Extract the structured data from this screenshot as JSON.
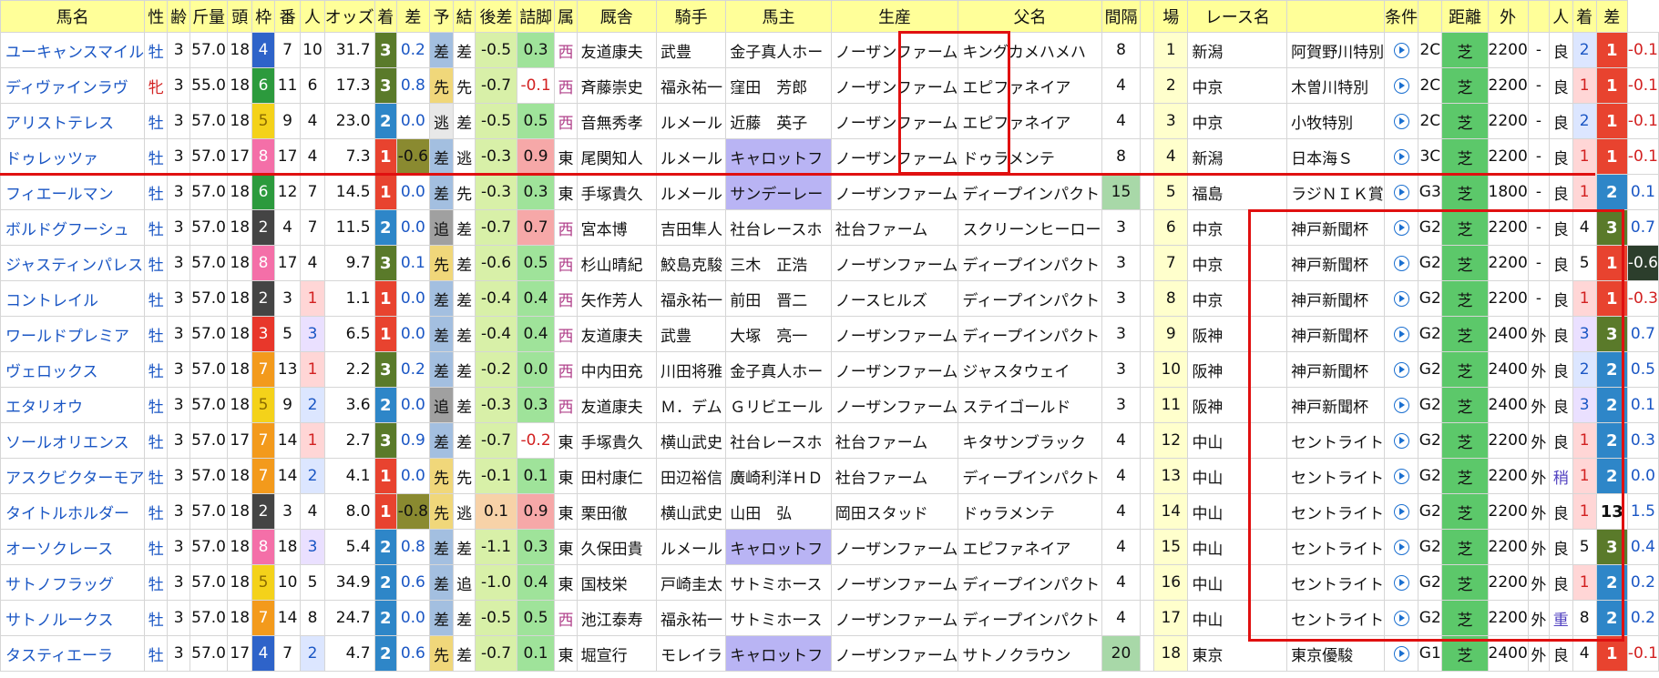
{
  "headers": [
    "馬名",
    "性",
    "齢",
    "斤量",
    "頭",
    "枠",
    "番",
    "人",
    "オッズ",
    "着",
    "差",
    "予",
    "結",
    "後差",
    "詰脚",
    "属",
    "厩舎",
    "騎手",
    "馬主",
    "生産",
    "父名",
    "間隔",
    "",
    "場",
    "レース名",
    "",
    "条件",
    "",
    "距離",
    "外",
    "",
    "人",
    "着",
    "差"
  ],
  "colors": {
    "header_bg": "#ffff99",
    "waku": {
      "1": "#f2f2f2",
      "2": "#444444",
      "3": "#e8372b",
      "4": "#2e63c9",
      "5": "#f4d21a",
      "6": "#2c9a3d",
      "7": "#f39a1c",
      "8": "#f46fa8"
    },
    "rank": {
      "1": "#e8432f",
      "2": "#2e86c8",
      "3": "#5a7a2a",
      "other": "#ffffff"
    },
    "pace": {
      "差": "#a3bfe0",
      "先": "#f0d77a",
      "逃": "#e8e8e8",
      "追": "#a0a0a0"
    },
    "ninki": {
      "1": "#ffd6d6",
      "2": "#dce6ff",
      "3": "#eae0ff"
    },
    "owner_highlight": "#b9b4f4",
    "turf": "#5cc86a",
    "kankaku_highlight": "#a8d8a8",
    "red": "#e01010"
  },
  "rows": [
    {
      "name": "ユーキャンスマイル",
      "sex": "牡",
      "age": "3",
      "kinryo": "57.0",
      "heads": "18",
      "waku": "4",
      "ban": "7",
      "ninki": "10",
      "odds": "31.7",
      "chaku": "3",
      "sa": "0.2",
      "yo": "差",
      "ketsu": "差",
      "kosa": "-0.5",
      "tsume": "0.3",
      "zoku": "西",
      "kyusha": "友道康夫",
      "kishu": "武豊",
      "banushi": "金子真人ホー",
      "seisan": "ノーザンファーム",
      "chichi": "キングカメハメハ",
      "kankaku": "8",
      "no": "1",
      "ba": "新潟",
      "race": "阿賀野川特別",
      "cond": "2C",
      "surface": "芝",
      "dist": "2200",
      "soto": "-",
      "baba": "良",
      "p_ninki": "2",
      "p_chaku": "1",
      "p_sa": "-0.1"
    },
    {
      "name": "ディヴァインラヴ",
      "sex": "牝",
      "age": "3",
      "kinryo": "55.0",
      "heads": "18",
      "waku": "6",
      "ban": "11",
      "ninki": "6",
      "odds": "17.3",
      "chaku": "3",
      "sa": "0.8",
      "yo": "先",
      "ketsu": "先",
      "kosa": "-0.7",
      "tsume": "-0.1",
      "zoku": "西",
      "kyusha": "斉藤崇史",
      "kishu": "福永祐一",
      "banushi": "窪田　芳郎",
      "seisan": "ノーザンファーム",
      "chichi": "エピファネイア",
      "kankaku": "4",
      "no": "2",
      "ba": "中京",
      "race": "木曽川特別",
      "cond": "2C",
      "surface": "芝",
      "dist": "2200",
      "soto": "-",
      "baba": "良",
      "p_ninki": "1",
      "p_chaku": "1",
      "p_sa": "-0.1"
    },
    {
      "name": "アリストテレス",
      "sex": "牡",
      "age": "3",
      "kinryo": "57.0",
      "heads": "18",
      "waku": "5",
      "ban": "9",
      "ninki": "4",
      "odds": "23.0",
      "chaku": "2",
      "sa": "0.0",
      "yo": "逃",
      "ketsu": "差",
      "kosa": "-0.5",
      "tsume": "0.5",
      "zoku": "西",
      "kyusha": "音無秀孝",
      "kishu": "ルメール",
      "banushi": "近藤　英子",
      "seisan": "ノーザンファーム",
      "chichi": "エピファネイア",
      "kankaku": "4",
      "no": "3",
      "ba": "中京",
      "race": "小牧特別",
      "cond": "2C",
      "surface": "芝",
      "dist": "2200",
      "soto": "-",
      "baba": "良",
      "p_ninki": "2",
      "p_chaku": "1",
      "p_sa": "-0.1"
    },
    {
      "name": "ドゥレッツァ",
      "sex": "牡",
      "age": "3",
      "kinryo": "57.0",
      "heads": "17",
      "waku": "8",
      "ban": "17",
      "ninki": "4",
      "odds": "7.3",
      "chaku": "1",
      "sa": "-0.6",
      "yo": "差",
      "ketsu": "逃",
      "kosa": "-0.3",
      "tsume": "0.9",
      "zoku": "東",
      "kyusha": "尾関知人",
      "kishu": "ルメール",
      "banushi": "キャロットフ",
      "seisan": "ノーザンファーム",
      "chichi": "ドゥラメンテ",
      "kankaku": "8",
      "no": "4",
      "ba": "新潟",
      "race": "日本海Ｓ",
      "cond": "3C",
      "surface": "芝",
      "dist": "2200",
      "soto": "-",
      "baba": "良",
      "p_ninki": "1",
      "p_chaku": "1",
      "p_sa": "-0.1"
    },
    {
      "name": "フィエールマン",
      "sex": "牡",
      "age": "3",
      "kinryo": "57.0",
      "heads": "18",
      "waku": "6",
      "ban": "12",
      "ninki": "7",
      "odds": "14.5",
      "chaku": "1",
      "sa": "0.0",
      "yo": "差",
      "ketsu": "先",
      "kosa": "-0.3",
      "tsume": "0.3",
      "zoku": "東",
      "kyusha": "手塚貴久",
      "kishu": "ルメール",
      "banushi": "サンデーレー",
      "seisan": "ノーザンファーム",
      "chichi": "ディープインパクト",
      "kankaku": "15",
      "no": "5",
      "ba": "福島",
      "race": "ラジＮＩＫ賞",
      "cond": "G3",
      "surface": "芝",
      "dist": "1800",
      "soto": "-",
      "baba": "良",
      "p_ninki": "1",
      "p_chaku": "2",
      "p_sa": "0.1"
    },
    {
      "name": "ボルドグフーシュ",
      "sex": "牡",
      "age": "3",
      "kinryo": "57.0",
      "heads": "18",
      "waku": "2",
      "ban": "4",
      "ninki": "7",
      "odds": "11.5",
      "chaku": "2",
      "sa": "0.0",
      "yo": "追",
      "ketsu": "差",
      "kosa": "-0.7",
      "tsume": "0.7",
      "zoku": "西",
      "kyusha": "宮本博",
      "kishu": "吉田隼人",
      "banushi": "社台レースホ",
      "seisan": "社台ファーム",
      "chichi": "スクリーンヒーロー",
      "kankaku": "3",
      "no": "6",
      "ba": "中京",
      "race": "神戸新聞杯",
      "cond": "G2",
      "surface": "芝",
      "dist": "2200",
      "soto": "-",
      "baba": "良",
      "p_ninki": "4",
      "p_chaku": "3",
      "p_sa": "0.7"
    },
    {
      "name": "ジャスティンパレス",
      "sex": "牡",
      "age": "3",
      "kinryo": "57.0",
      "heads": "18",
      "waku": "8",
      "ban": "17",
      "ninki": "4",
      "odds": "9.7",
      "chaku": "3",
      "sa": "0.1",
      "yo": "先",
      "ketsu": "差",
      "kosa": "-0.6",
      "tsume": "0.5",
      "zoku": "西",
      "kyusha": "杉山晴紀",
      "kishu": "鮫島克駿",
      "banushi": "三木　正浩",
      "seisan": "ノーザンファーム",
      "chichi": "ディープインパクト",
      "kankaku": "3",
      "no": "7",
      "ba": "中京",
      "race": "神戸新聞杯",
      "cond": "G2",
      "surface": "芝",
      "dist": "2200",
      "soto": "-",
      "baba": "良",
      "p_ninki": "5",
      "p_chaku": "1",
      "p_sa": "-0.6"
    },
    {
      "name": "コントレイル",
      "sex": "牡",
      "age": "3",
      "kinryo": "57.0",
      "heads": "18",
      "waku": "2",
      "ban": "3",
      "ninki": "1",
      "odds": "1.1",
      "chaku": "1",
      "sa": "0.0",
      "yo": "差",
      "ketsu": "差",
      "kosa": "-0.4",
      "tsume": "0.4",
      "zoku": "西",
      "kyusha": "矢作芳人",
      "kishu": "福永祐一",
      "banushi": "前田　晋二",
      "seisan": "ノースヒルズ",
      "chichi": "ディープインパクト",
      "kankaku": "3",
      "no": "8",
      "ba": "中京",
      "race": "神戸新聞杯",
      "cond": "G2",
      "surface": "芝",
      "dist": "2200",
      "soto": "-",
      "baba": "良",
      "p_ninki": "1",
      "p_chaku": "1",
      "p_sa": "-0.3"
    },
    {
      "name": "ワールドプレミア",
      "sex": "牡",
      "age": "3",
      "kinryo": "57.0",
      "heads": "18",
      "waku": "3",
      "ban": "5",
      "ninki": "3",
      "odds": "6.5",
      "chaku": "1",
      "sa": "0.0",
      "yo": "差",
      "ketsu": "差",
      "kosa": "-0.4",
      "tsume": "0.4",
      "zoku": "西",
      "kyusha": "友道康夫",
      "kishu": "武豊",
      "banushi": "大塚　亮一",
      "seisan": "ノーザンファーム",
      "chichi": "ディープインパクト",
      "kankaku": "3",
      "no": "9",
      "ba": "阪神",
      "race": "神戸新聞杯",
      "cond": "G2",
      "surface": "芝",
      "dist": "2400",
      "soto": "外",
      "baba": "良",
      "p_ninki": "3",
      "p_chaku": "3",
      "p_sa": "0.7"
    },
    {
      "name": "ヴェロックス",
      "sex": "牡",
      "age": "3",
      "kinryo": "57.0",
      "heads": "18",
      "waku": "7",
      "ban": "13",
      "ninki": "1",
      "odds": "2.2",
      "chaku": "3",
      "sa": "0.2",
      "yo": "差",
      "ketsu": "差",
      "kosa": "-0.2",
      "tsume": "0.0",
      "zoku": "西",
      "kyusha": "中内田充",
      "kishu": "川田将雅",
      "banushi": "金子真人ホー",
      "seisan": "ノーザンファーム",
      "chichi": "ジャスタウェイ",
      "kankaku": "3",
      "no": "10",
      "ba": "阪神",
      "race": "神戸新聞杯",
      "cond": "G2",
      "surface": "芝",
      "dist": "2400",
      "soto": "外",
      "baba": "良",
      "p_ninki": "2",
      "p_chaku": "2",
      "p_sa": "0.5"
    },
    {
      "name": "エタリオウ",
      "sex": "牡",
      "age": "3",
      "kinryo": "57.0",
      "heads": "18",
      "waku": "5",
      "ban": "9",
      "ninki": "2",
      "odds": "3.6",
      "chaku": "2",
      "sa": "0.0",
      "yo": "追",
      "ketsu": "差",
      "kosa": "-0.3",
      "tsume": "0.3",
      "zoku": "西",
      "kyusha": "友道康夫",
      "kishu": "Ｍ．デム",
      "banushi": "Ｇリビエール",
      "seisan": "ノーザンファーム",
      "chichi": "ステイゴールド",
      "kankaku": "3",
      "no": "11",
      "ba": "阪神",
      "race": "神戸新聞杯",
      "cond": "G2",
      "surface": "芝",
      "dist": "2400",
      "soto": "外",
      "baba": "良",
      "p_ninki": "3",
      "p_chaku": "2",
      "p_sa": "0.1"
    },
    {
      "name": "ソールオリエンス",
      "sex": "牡",
      "age": "3",
      "kinryo": "57.0",
      "heads": "17",
      "waku": "7",
      "ban": "14",
      "ninki": "1",
      "odds": "2.7",
      "chaku": "3",
      "sa": "0.9",
      "yo": "差",
      "ketsu": "差",
      "kosa": "-0.7",
      "tsume": "-0.2",
      "zoku": "東",
      "kyusha": "手塚貴久",
      "kishu": "横山武史",
      "banushi": "社台レースホ",
      "seisan": "社台ファーム",
      "chichi": "キタサンブラック",
      "kankaku": "4",
      "no": "12",
      "ba": "中山",
      "race": "セントライト",
      "cond": "G2",
      "surface": "芝",
      "dist": "2200",
      "soto": "外",
      "baba": "良",
      "p_ninki": "1",
      "p_chaku": "2",
      "p_sa": "0.3"
    },
    {
      "name": "アスクビクターモア",
      "sex": "牡",
      "age": "3",
      "kinryo": "57.0",
      "heads": "18",
      "waku": "7",
      "ban": "14",
      "ninki": "2",
      "odds": "4.1",
      "chaku": "1",
      "sa": "0.0",
      "yo": "先",
      "ketsu": "先",
      "kosa": "-0.1",
      "tsume": "0.1",
      "zoku": "東",
      "kyusha": "田村康仁",
      "kishu": "田辺裕信",
      "banushi": "廣崎利洋ＨＤ",
      "seisan": "社台ファーム",
      "chichi": "ディープインパクト",
      "kankaku": "4",
      "no": "13",
      "ba": "中山",
      "race": "セントライト",
      "cond": "G2",
      "surface": "芝",
      "dist": "2200",
      "soto": "外",
      "baba": "稍",
      "p_ninki": "1",
      "p_chaku": "2",
      "p_sa": "0.0"
    },
    {
      "name": "タイトルホルダー",
      "sex": "牡",
      "age": "3",
      "kinryo": "57.0",
      "heads": "18",
      "waku": "2",
      "ban": "3",
      "ninki": "4",
      "odds": "8.0",
      "chaku": "1",
      "sa": "-0.8",
      "yo": "先",
      "ketsu": "逃",
      "kosa": "0.1",
      "tsume": "0.9",
      "zoku": "東",
      "kyusha": "栗田徹",
      "kishu": "横山武史",
      "banushi": "山田　弘",
      "seisan": "岡田スタッド",
      "chichi": "ドゥラメンテ",
      "kankaku": "4",
      "no": "14",
      "ba": "中山",
      "race": "セントライト",
      "cond": "G2",
      "surface": "芝",
      "dist": "2200",
      "soto": "外",
      "baba": "良",
      "p_ninki": "1",
      "p_chaku": "13",
      "p_sa": "1.5"
    },
    {
      "name": "オーソクレース",
      "sex": "牡",
      "age": "3",
      "kinryo": "57.0",
      "heads": "18",
      "waku": "8",
      "ban": "18",
      "ninki": "3",
      "odds": "5.4",
      "chaku": "2",
      "sa": "0.8",
      "yo": "差",
      "ketsu": "差",
      "kosa": "-1.1",
      "tsume": "0.3",
      "zoku": "東",
      "kyusha": "久保田貴",
      "kishu": "ルメール",
      "banushi": "キャロットフ",
      "seisan": "ノーザンファーム",
      "chichi": "エピファネイア",
      "kankaku": "4",
      "no": "15",
      "ba": "中山",
      "race": "セントライト",
      "cond": "G2",
      "surface": "芝",
      "dist": "2200",
      "soto": "外",
      "baba": "良",
      "p_ninki": "5",
      "p_chaku": "3",
      "p_sa": "0.4"
    },
    {
      "name": "サトノフラッグ",
      "sex": "牡",
      "age": "3",
      "kinryo": "57.0",
      "heads": "18",
      "waku": "5",
      "ban": "10",
      "ninki": "5",
      "odds": "34.9",
      "chaku": "2",
      "sa": "0.6",
      "yo": "差",
      "ketsu": "追",
      "kosa": "-1.0",
      "tsume": "0.4",
      "zoku": "東",
      "kyusha": "国枝栄",
      "kishu": "戸崎圭太",
      "banushi": "サトミホース",
      "seisan": "ノーザンファーム",
      "chichi": "ディープインパクト",
      "kankaku": "4",
      "no": "16",
      "ba": "中山",
      "race": "セントライト",
      "cond": "G2",
      "surface": "芝",
      "dist": "2200",
      "soto": "外",
      "baba": "良",
      "p_ninki": "1",
      "p_chaku": "2",
      "p_sa": "0.2"
    },
    {
      "name": "サトノルークス",
      "sex": "牡",
      "age": "3",
      "kinryo": "57.0",
      "heads": "18",
      "waku": "7",
      "ban": "14",
      "ninki": "8",
      "odds": "24.7",
      "chaku": "2",
      "sa": "0.0",
      "yo": "差",
      "ketsu": "差",
      "kosa": "-0.5",
      "tsume": "0.5",
      "zoku": "西",
      "kyusha": "池江泰寿",
      "kishu": "福永祐一",
      "banushi": "サトミホース",
      "seisan": "ノーザンファーム",
      "chichi": "ディープインパクト",
      "kankaku": "4",
      "no": "17",
      "ba": "中山",
      "race": "セントライト",
      "cond": "G2",
      "surface": "芝",
      "dist": "2200",
      "soto": "外",
      "baba": "重",
      "p_ninki": "8",
      "p_chaku": "2",
      "p_sa": "0.2"
    },
    {
      "name": "タスティエーラ",
      "sex": "牡",
      "age": "3",
      "kinryo": "57.0",
      "heads": "17",
      "waku": "4",
      "ban": "7",
      "ninki": "2",
      "odds": "4.7",
      "chaku": "2",
      "sa": "0.6",
      "yo": "先",
      "ketsu": "差",
      "kosa": "-0.7",
      "tsume": "0.1",
      "zoku": "東",
      "kyusha": "堀宣行",
      "kishu": "モレイラ",
      "banushi": "キャロットフ",
      "seisan": "ノーザンファーム",
      "chichi": "サトノクラウン",
      "kankaku": "20",
      "no": "18",
      "ba": "東京",
      "race": "東京優駿",
      "cond": "G1",
      "surface": "芝",
      "dist": "2400",
      "soto": "外",
      "baba": "良",
      "p_ninki": "4",
      "p_chaku": "1",
      "p_sa": "-0.1"
    }
  ]
}
